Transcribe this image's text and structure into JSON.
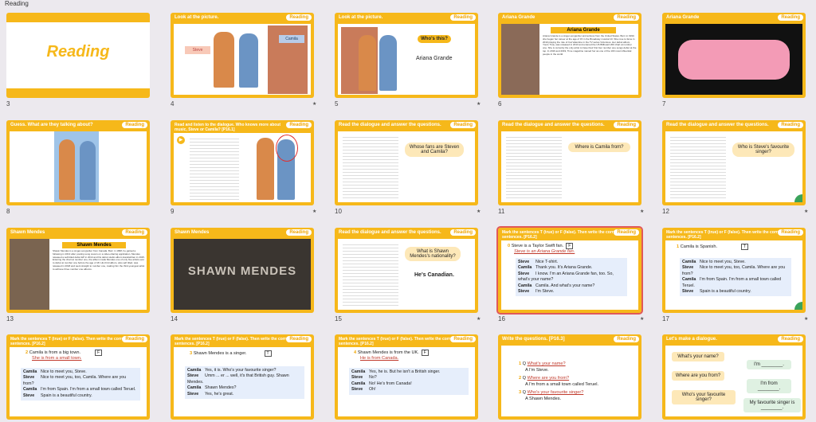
{
  "app": {
    "title": "Reading"
  },
  "slides": {
    "s3": {
      "num": "3",
      "title": "Reading"
    },
    "s4": {
      "num": "4",
      "title": "Look at the picture.",
      "tag": "Reading",
      "steve": "Steve",
      "camila": "Camila"
    },
    "s5": {
      "num": "5",
      "title": "Look at the picture.",
      "tag": "Reading",
      "q": "Who's this?",
      "a": "Ariana Grande"
    },
    "s6": {
      "num": "6",
      "title": "Ariana Grande",
      "tag": "Reading",
      "head": "Ariana Grande",
      "text": "Ariana Grande is a singer-songwriter and actress from the United States. Born in 1993, she began her career at the age of 15 in the Broadway musical 13. She rose to fame in 2010 playing the role of Cat Valentine in the TV series Victorious. Her debut album, Yours Truly, was released in 2013 and entered the US Billboard 200 chart at number one. She is currently the only artist to have their first four number one songs debut at the top. In 2016 and 2019, Time magazine named her as one of the 100 most influential people in the world."
    },
    "s7": {
      "num": "7",
      "title": "Ariana Grande",
      "tag": "Reading"
    },
    "s8": {
      "num": "8",
      "title": "Guess. What are they talking about?",
      "tag": "Reading"
    },
    "s9": {
      "num": "9",
      "title": "Read and listen to the dialogue. Who knows more about music, Steve or Camila? [P16.1]",
      "tag": "Reading"
    },
    "s10": {
      "num": "10",
      "title": "Read the dialogue and answer the questions.",
      "tag": "Reading",
      "q": "Whose fans are Steven and Camila?"
    },
    "s11": {
      "num": "11",
      "title": "Read the dialogue and answer the questions.",
      "tag": "Reading",
      "q": "Where is Camila from?"
    },
    "s12": {
      "num": "12",
      "title": "Read the dialogue and answer the questions.",
      "tag": "Reading",
      "q": "Who is Steve's favourite singer?"
    },
    "s13": {
      "num": "13",
      "title": "Shawn Mendes",
      "tag": "Reading",
      "head": "Shawn Mendes",
      "text": "Shawn Mendes is a singer-songwriter from Canada. Born in 1998, he gained a following in 2013 after posting song covers on a video-sharing application. Mendes released a self-titled debut EP in 2014 and his debut studio album Handwritten in 2015. Entering the chart at number one, the album made Mendes one of only five artists ever to debut at number one before the age of 18. His third album, also self titled, was released in 2018 and went straight to number one, making him the third-youngest artist to achieve three number one albums."
    },
    "s14": {
      "num": "14",
      "title": "Shawn Mendes",
      "tag": "Reading",
      "img": "SHAWN MENDES"
    },
    "s15": {
      "num": "15",
      "title": "Read the dialogue and answer the questions.",
      "tag": "Reading",
      "q": "What is Shawn Mendes's nationality?",
      "a": "He's Canadian."
    },
    "s16": {
      "num": "16",
      "title": "Mark the sentences T (true) or F (false). Then write the correct sentences. [P16.2]",
      "tag": "Reading",
      "n": "0",
      "stmt": "Steve is a Taylor Swift fan.",
      "mark": "F",
      "fix": "Steve is an Ariana Grande fan.",
      "rows": [
        {
          "who": "Steve",
          "say": "Nice T-shirt."
        },
        {
          "who": "Camila",
          "say": "Thank you. It's Ariana Grande."
        },
        {
          "who": "Steve",
          "say": "I know. I'm an Ariana Grande fan, too. So, what's your name?"
        },
        {
          "who": "Camila",
          "say": "Camila. And what's your name?"
        },
        {
          "who": "Steve",
          "say": "I'm Steve."
        }
      ]
    },
    "s17": {
      "num": "17",
      "title": "Mark the sentences T (true) or F (false). Then write the correct sentences. [P16.2]",
      "tag": "Reading",
      "n": "1",
      "stmt": "Camila is Spanish.",
      "mark": "T",
      "rows": [
        {
          "who": "Camila",
          "say": "Nice to meet you, Steve."
        },
        {
          "who": "Steve",
          "say": "Nice to meet you, too, Camila. Where are you from?"
        },
        {
          "who": "Camila",
          "say": "I'm from Spain. I'm from a small town called Teruel."
        },
        {
          "who": "Steve",
          "say": "Spain is a beautiful country."
        }
      ]
    },
    "s18": {
      "num": "18",
      "title": "Mark the sentences T (true) or F (false). Then write the correct sentences. [P16.2]",
      "tag": "Reading",
      "n": "2",
      "stmt": "Camila is from a big town.",
      "mark": "F",
      "fix": "She is from a small town.",
      "rows": [
        {
          "who": "Camila",
          "say": "Nice to meet you, Steve."
        },
        {
          "who": "Steve",
          "say": "Nice to meet you, too, Camila. Where are you from?"
        },
        {
          "who": "Camila",
          "say": "I'm from Spain. I'm from a small town called Teruel."
        },
        {
          "who": "Steve",
          "say": "Spain is a beautiful country."
        }
      ]
    },
    "s19": {
      "num": "19",
      "title": "Mark the sentences T (true) or F (false). Then write the correct sentences. [P16.2]",
      "tag": "Reading",
      "n": "3",
      "stmt": "Shawn Mendes is a singer.",
      "mark": "T",
      "rows": [
        {
          "who": "Camila",
          "say": "Yes, it is. Who's your favourite singer?"
        },
        {
          "who": "Steve",
          "say": "Umm ... er ... well, it's that British guy. Shawn Mendes."
        },
        {
          "who": "Camila",
          "say": "Shawn Mendes?"
        },
        {
          "who": "Steve",
          "say": "Yes, he's great."
        }
      ]
    },
    "s20": {
      "num": "20",
      "title": "Mark the sentences T (true) or F (false). Then write the correct sentences. [P16.2]",
      "tag": "Reading",
      "n": "4",
      "stmt": "Shawn Mendes is from the UK.",
      "mark": "F",
      "fix": "He is from Canada.",
      "rows": [
        {
          "who": "Camila",
          "say": "Yes, he is. But he isn't a British singer."
        },
        {
          "who": "Steve",
          "say": "No?"
        },
        {
          "who": "Camila",
          "say": "No! He's from Canada!"
        },
        {
          "who": "Steve",
          "say": "Oh!"
        }
      ]
    },
    "s21": {
      "num": "21",
      "title": "Write the questions. [P16.3]",
      "tag": "Reading",
      "items": [
        {
          "n": "1",
          "q": "What's your name?",
          "a": "I'm Steve."
        },
        {
          "n": "2",
          "q": "Where are you from?",
          "a": "I'm from a small town called Teruel."
        },
        {
          "n": "3",
          "q": "Who's your favourite singer?",
          "a": "Shawn Mendes."
        }
      ]
    },
    "s22": {
      "num": "22",
      "title": "Let's make a dialogue.",
      "tag": "Reading",
      "left": [
        "What's your name?",
        "Where are you from?",
        "Who's your favourite singer?"
      ],
      "right": [
        "I'm ________.",
        "I'm from ________.",
        "My favourite singer is ________."
      ]
    }
  }
}
